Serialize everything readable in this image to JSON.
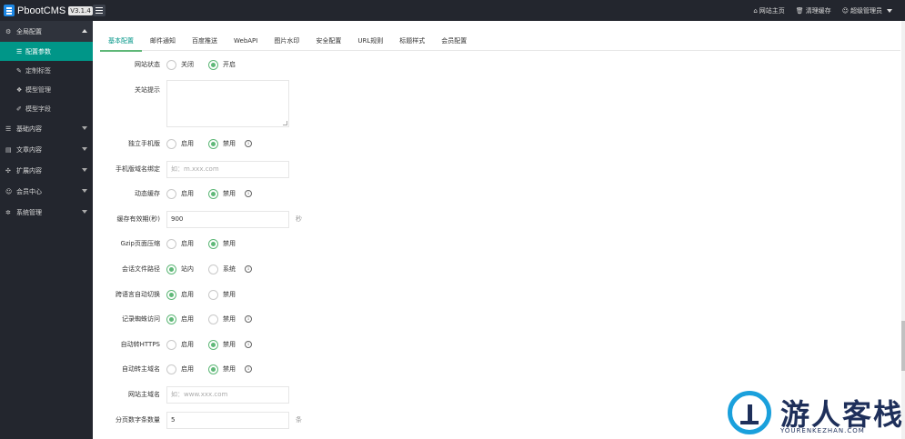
{
  "app": {
    "name": "PbootCMS",
    "version": "V3.1.4"
  },
  "top_links": [
    {
      "icon": "home-icon",
      "glyph": "⌂",
      "label": "网站主页"
    },
    {
      "icon": "trash-icon",
      "glyph": "🗑",
      "label": "清理缓存"
    },
    {
      "icon": "user-icon",
      "glyph": "☺",
      "label": "超级管理员"
    }
  ],
  "sidebar": {
    "groups": [
      {
        "label": "全局配置",
        "icon": "gear-icon",
        "glyph": "⚙",
        "open": true,
        "items": [
          {
            "label": "配置参数",
            "icon": "sliders-icon",
            "glyph": "☰",
            "active": true
          },
          {
            "label": "定制标签",
            "icon": "wrench-icon",
            "glyph": "✎"
          },
          {
            "label": "模型管理",
            "icon": "cube-icon",
            "glyph": "❖"
          },
          {
            "label": "模型字段",
            "icon": "edit-icon",
            "glyph": "✐"
          }
        ]
      },
      {
        "label": "基础内容",
        "icon": "list-icon",
        "glyph": "☰"
      },
      {
        "label": "文章内容",
        "icon": "file-icon",
        "glyph": "▤"
      },
      {
        "label": "扩展内容",
        "icon": "expand-icon",
        "glyph": "✣"
      },
      {
        "label": "会员中心",
        "icon": "member-icon",
        "glyph": "☺"
      },
      {
        "label": "系统管理",
        "icon": "settings-icon",
        "glyph": "✲"
      }
    ]
  },
  "tabs": [
    "基本配置",
    "邮件通知",
    "百度推送",
    "WebAPI",
    "图片水印",
    "安全配置",
    "URL规则",
    "标题样式",
    "会员配置"
  ],
  "active_tab": 0,
  "form": {
    "site_status": {
      "label": "网站状态",
      "options": [
        "关闭",
        "开启"
      ],
      "selected": 1
    },
    "close_notice": {
      "label": "关站提示",
      "value": ""
    },
    "mobile_site": {
      "label": "独立手机版",
      "options": [
        "启用",
        "禁用"
      ],
      "selected": 1
    },
    "mobile_domain": {
      "label": "手机版域名绑定",
      "placeholder": "如：m.xxx.com"
    },
    "dynamic_cache": {
      "label": "动态缓存",
      "options": [
        "启用",
        "禁用"
      ],
      "selected": 1
    },
    "cache_time": {
      "label": "缓存有效期(秒)",
      "value": "900",
      "unit": "秒"
    },
    "gzip": {
      "label": "Gzip页面压缩",
      "options": [
        "启用",
        "禁用"
      ],
      "selected": 1
    },
    "upload_path": {
      "label": "会话文件路径",
      "options": [
        "站内",
        "系统"
      ],
      "selected": 0
    },
    "lang_switch": {
      "label": "跨语言自动切换",
      "options": [
        "启用",
        "禁用"
      ],
      "selected": 0
    },
    "spider_log": {
      "label": "记录蜘蛛访问",
      "options": [
        "启用",
        "禁用"
      ],
      "selected": 0
    },
    "auto_https": {
      "label": "自动转HTTPS",
      "options": [
        "启用",
        "禁用"
      ],
      "selected": 1
    },
    "auto_domain": {
      "label": "自动转主域名",
      "options": [
        "启用",
        "禁用"
      ],
      "selected": 1
    },
    "main_domain": {
      "label": "网站主域名",
      "placeholder": "如：www.xxx.com"
    },
    "page_count": {
      "label": "分页数字条数量",
      "value": "5",
      "unit": "条"
    }
  },
  "watermark": {
    "title": "游人客栈",
    "url": "YOURENKEZHAN.COM"
  }
}
